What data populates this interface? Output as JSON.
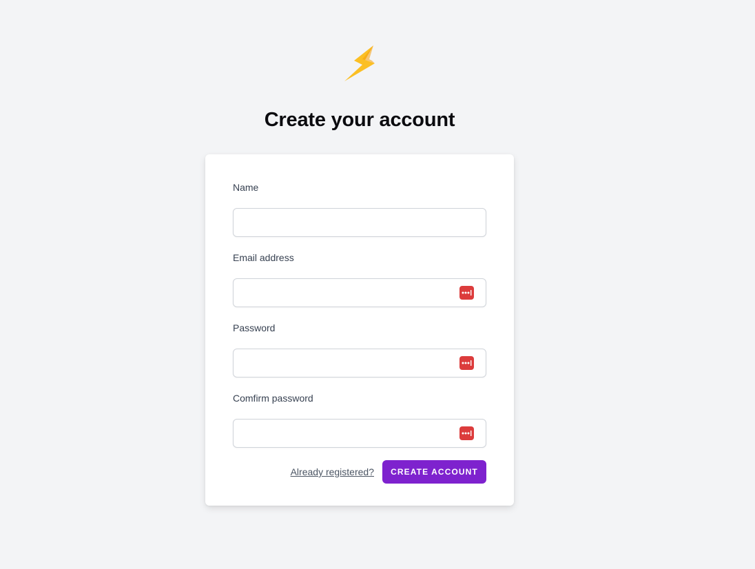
{
  "brand": {
    "logo_icon": "lightning-bolt-icon",
    "logo_color": "#fbbf24"
  },
  "page": {
    "title": "Create your account"
  },
  "form": {
    "name": {
      "label": "Name",
      "value": ""
    },
    "email": {
      "label": "Email address",
      "value": "",
      "icon": "password-manager-icon"
    },
    "password": {
      "label": "Password",
      "value": "",
      "icon": "password-manager-icon"
    },
    "confirm_password": {
      "label": "Comfirm password",
      "value": "",
      "icon": "password-manager-icon"
    }
  },
  "actions": {
    "login_link": "Already registered?",
    "submit_label": "CREATE ACCOUNT"
  },
  "colors": {
    "background": "#f3f4f6",
    "primary_button": "#7e22ce",
    "password_icon": "#dc3c3c"
  }
}
